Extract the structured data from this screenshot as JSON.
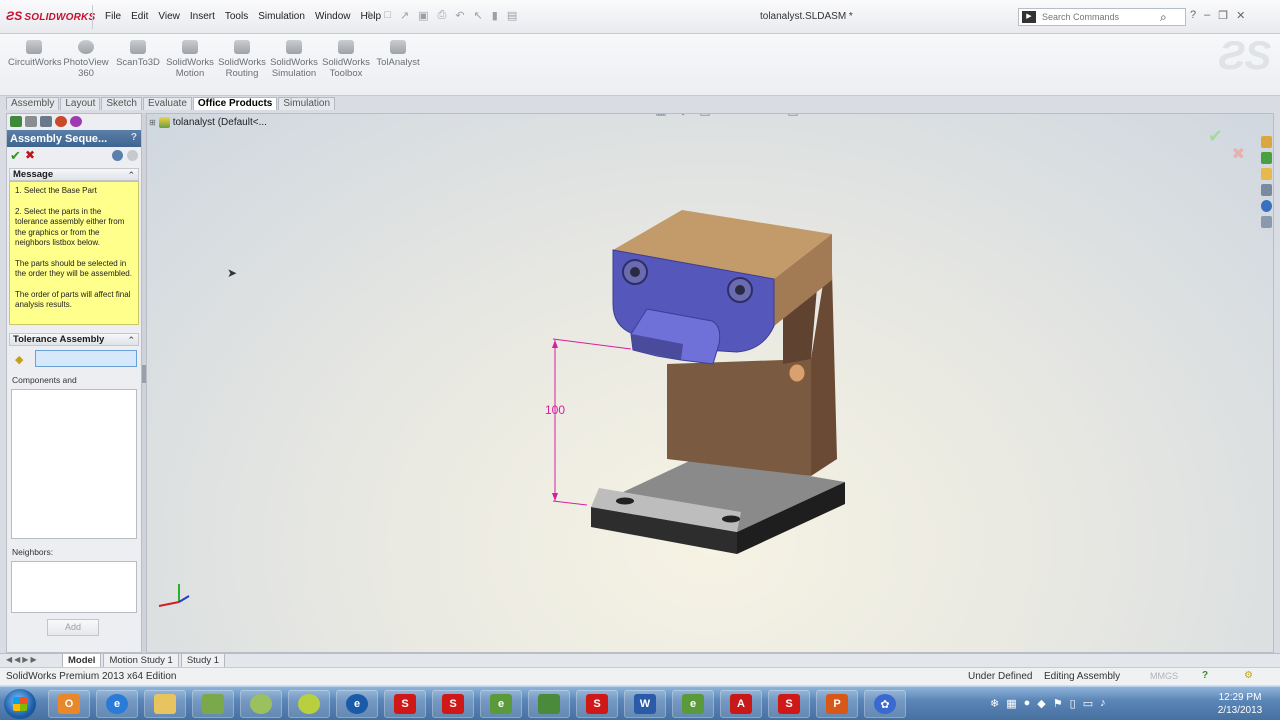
{
  "app": {
    "logo_text": "SOLIDWORKS",
    "document_title": "tolanalyst.SLDASM *"
  },
  "menu": [
    "File",
    "Edit",
    "View",
    "Insert",
    "Tools",
    "Simulation",
    "Window",
    "Help"
  ],
  "search": {
    "placeholder": "Search Commands"
  },
  "command_manager": [
    {
      "label": "CircuitWorks"
    },
    {
      "label": "PhotoView 360"
    },
    {
      "label": "ScanTo3D"
    },
    {
      "label": "SolidWorks Motion"
    },
    {
      "label": "SolidWorks Routing"
    },
    {
      "label": "SolidWorks Simulation"
    },
    {
      "label": "SolidWorks Toolbox"
    },
    {
      "label": "TolAnalyst"
    }
  ],
  "tabs": [
    {
      "label": "Assembly",
      "active": false
    },
    {
      "label": "Layout",
      "active": false
    },
    {
      "label": "Sketch",
      "active": false
    },
    {
      "label": "Evaluate",
      "active": false
    },
    {
      "label": "Office Products",
      "active": true
    },
    {
      "label": "Simulation",
      "active": false
    }
  ],
  "property_manager": {
    "title": "Assembly Seque...",
    "message_group": "Message",
    "message_lines": [
      "1. Select the Base Part",
      "2. Select the parts in the tolerance assembly either from the graphics or from the neighbors listbox below.",
      "The parts should be selected in the order they will be assembled.",
      "The order of parts will affect final analysis results."
    ],
    "tolerance_group": "Tolerance Assembly",
    "components_label": "Components and",
    "neighbors_label": "Neighbors:",
    "add_label": "Add"
  },
  "feature_tree": {
    "root": "tolanalyst  (Default<..."
  },
  "dimension": {
    "value": "100"
  },
  "bottom_tabs": [
    {
      "label": "Model",
      "active": true
    },
    {
      "label": "Motion Study 1",
      "active": false
    },
    {
      "label": "Study 1",
      "active": false
    }
  ],
  "status": {
    "edition": "SolidWorks Premium 2013 x64 Edition",
    "definition": "Under Defined",
    "mode": "Editing Assembly",
    "units": "MMGS"
  },
  "taskbar": {
    "time": "12:29 PM",
    "date": "2/13/2013"
  },
  "colors": {
    "brand_red": "#c8102e",
    "clamp_blue": "#5556b8",
    "body_brown": "#8a6448",
    "dimension_magenta": "#d81ea0"
  }
}
